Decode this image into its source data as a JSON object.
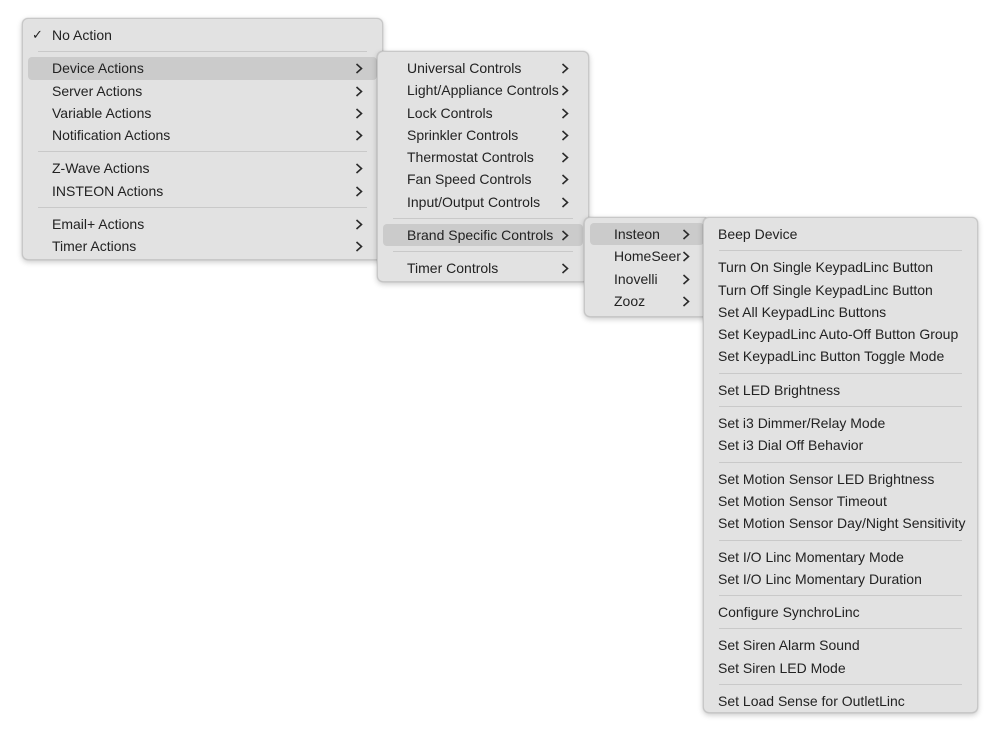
{
  "menu_root": {
    "items": [
      {
        "label": "No Action",
        "checked": true
      },
      {
        "label": "Device Actions"
      },
      {
        "label": "Server Actions"
      },
      {
        "label": "Variable Actions"
      },
      {
        "label": "Notification Actions"
      },
      {
        "label": "Z-Wave Actions"
      },
      {
        "label": "INSTEON Actions"
      },
      {
        "label": "Email+ Actions"
      },
      {
        "label": "Timer Actions"
      }
    ],
    "check_glyph": "✓"
  },
  "menu_device": {
    "items": [
      {
        "label": "Universal Controls"
      },
      {
        "label": "Light/Appliance Controls"
      },
      {
        "label": "Lock Controls"
      },
      {
        "label": "Sprinkler Controls"
      },
      {
        "label": "Thermostat Controls"
      },
      {
        "label": "Fan Speed Controls"
      },
      {
        "label": "Input/Output Controls"
      },
      {
        "label": "Brand Specific Controls"
      },
      {
        "label": "Timer Controls"
      }
    ]
  },
  "menu_brand": {
    "items": [
      {
        "label": "Insteon"
      },
      {
        "label": "HomeSeer"
      },
      {
        "label": "Inovelli"
      },
      {
        "label": "Zooz"
      }
    ]
  },
  "menu_insteon": {
    "items": [
      {
        "label": "Beep Device"
      },
      {
        "label": "Turn On Single KeypadLinc Button"
      },
      {
        "label": "Turn Off Single KeypadLinc Button"
      },
      {
        "label": "Set All KeypadLinc Buttons"
      },
      {
        "label": "Set KeypadLinc Auto-Off Button Group"
      },
      {
        "label": "Set KeypadLinc Button Toggle Mode"
      },
      {
        "label": "Set LED Brightness"
      },
      {
        "label": "Set i3 Dimmer/Relay Mode"
      },
      {
        "label": "Set i3 Dial Off Behavior"
      },
      {
        "label": "Set Motion Sensor LED Brightness"
      },
      {
        "label": "Set Motion Sensor Timeout"
      },
      {
        "label": "Set Motion Sensor Day/Night Sensitivity"
      },
      {
        "label": "Set I/O Linc Momentary Mode"
      },
      {
        "label": "Set I/O Linc Momentary Duration"
      },
      {
        "label": "Configure SynchroLinc"
      },
      {
        "label": "Set Siren Alarm Sound"
      },
      {
        "label": "Set Siren LED Mode"
      },
      {
        "label": "Set Load Sense for OutletLinc"
      }
    ]
  },
  "icons": {
    "submenu": "chevron-right-icon",
    "check": "checkmark-icon"
  },
  "colors": {
    "menu_bg": "#e2e2e2",
    "highlight_bg": "#cbcbcb",
    "text": "#222222",
    "separator": "#c9c9c9"
  }
}
